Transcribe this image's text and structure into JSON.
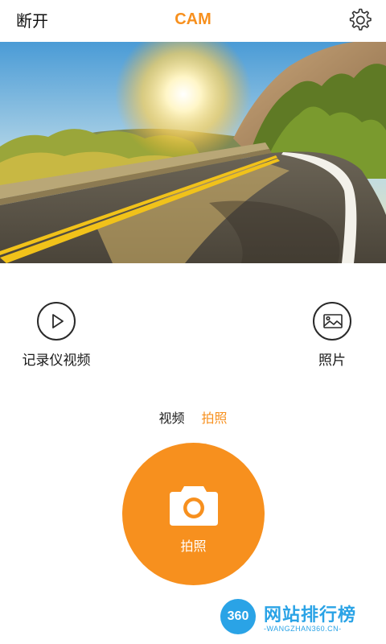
{
  "colors": {
    "accent": "#f7901e",
    "text": "#1a1a1a",
    "watermark": "#2aa3e6"
  },
  "header": {
    "disconnect_label": "断开",
    "title": "CAM",
    "settings_icon": "gear-icon"
  },
  "preview": {
    "image": "road-at-sunset-photo"
  },
  "modes": {
    "video": {
      "label": "记录仪视频",
      "icon": "play-icon"
    },
    "photo": {
      "label": "照片",
      "icon": "image-icon"
    }
  },
  "tabs": [
    {
      "label": "视频",
      "active": false
    },
    {
      "label": "拍照",
      "active": true
    }
  ],
  "capture": {
    "label": "拍照",
    "icon": "camera-icon"
  },
  "watermark": {
    "badge": "360",
    "title": "网站排行榜",
    "subtitle": "-WANGZHAN360.CN-"
  }
}
